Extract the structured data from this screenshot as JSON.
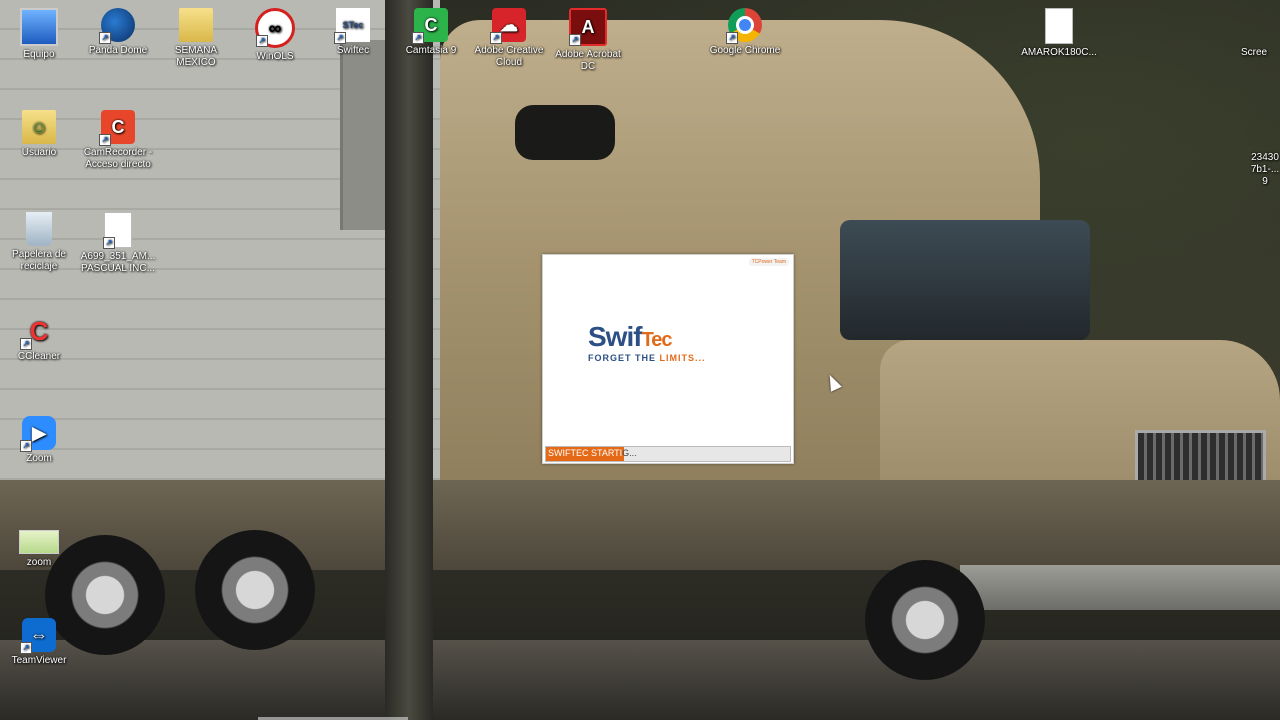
{
  "desktop": {
    "icons": [
      {
        "label": "Equipo"
      },
      {
        "label": "Panda Dome"
      },
      {
        "label": "SEMANA MEXICO"
      },
      {
        "label": "WinOLS"
      },
      {
        "label": "Swiftec"
      },
      {
        "label": "Camtasia 9"
      },
      {
        "label": "Adobe Creative Cloud"
      },
      {
        "label": "Adobe Acrobat DC"
      },
      {
        "label": "Google Chrome"
      },
      {
        "label": "AMAROK180C..."
      },
      {
        "label": "Scree"
      },
      {
        "label": "Usuario"
      },
      {
        "label": "CamRecorder - Acceso directo"
      },
      {
        "label": "Papelera de reciclaje"
      },
      {
        "label": "A699_351_AM... PASCUAL INC..."
      },
      {
        "label": "CCleaner"
      },
      {
        "label": "Zoom"
      },
      {
        "label": "zoom"
      },
      {
        "label": "TeamViewer"
      },
      {
        "label": "23430 7b1-... 9"
      }
    ]
  },
  "splash": {
    "tag": "TCPower Team",
    "logo_main": "Swif",
    "logo_tec": "Tec",
    "logo_sub": "FORGET THE ",
    "logo_limits": "LIMITS...",
    "status_filled": "SWIFTEC STARTI",
    "status_rest": "G...",
    "progress_percent": 32
  },
  "colors": {
    "accent": "#e56a18",
    "brand_blue": "#2c4f86"
  }
}
